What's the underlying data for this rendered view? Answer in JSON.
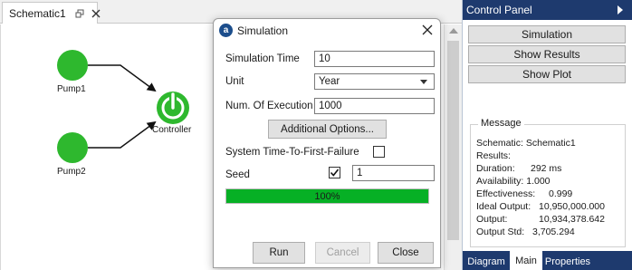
{
  "document": {
    "tab_label": "Schematic1"
  },
  "schematic": {
    "nodes": [
      {
        "label": "Pump1",
        "color": "#2eb82e",
        "shape": "circle"
      },
      {
        "label": "Pump2",
        "color": "#2eb82e",
        "shape": "circle"
      },
      {
        "label": "Controller",
        "color": "#2eb82e",
        "icon": "power-icon"
      }
    ],
    "connectors": [
      "Pump1 → Controller",
      "Pump2 → Controller"
    ]
  },
  "dialog": {
    "title": "Simulation",
    "app_icon_letter": "a",
    "fields": {
      "simulation_time_label": "Simulation Time",
      "simulation_time_value": "10",
      "unit_label": "Unit",
      "unit_value": "Year",
      "num_execution_label": "Num. Of Execution",
      "num_execution_value": "1000",
      "additional_options_label": "Additional Options...",
      "ttff_label": "System Time-To-First-Failure",
      "ttff_checked": false,
      "seed_label": "Seed",
      "seed_checked": true,
      "seed_value": "1"
    },
    "progress": {
      "fraction": 1.0,
      "text": "100%",
      "color": "#06b025"
    },
    "buttons": {
      "run": "Run",
      "cancel": "Cancel",
      "close": "Close"
    }
  },
  "control_panel": {
    "title": "Control Panel",
    "header_color": "#1e3a6e",
    "buttons": {
      "simulation": "Simulation",
      "show_results": "Show Results",
      "show_plot": "Show Plot"
    },
    "message": {
      "title": "Message",
      "lines": [
        {
          "label": "Schematic: Schematic1",
          "value": ""
        },
        {
          "label": "Results:",
          "value": ""
        },
        {
          "label": "Duration:",
          "value": "292 ms"
        },
        {
          "label": "Availability: 1.000",
          "value": ""
        },
        {
          "label": "Effectiveness:",
          "value": "0.999"
        },
        {
          "label": "Ideal Output:",
          "value": "10,950,000.000"
        },
        {
          "label": "Output:",
          "value": "10,934,378.642"
        },
        {
          "label": "Output Std:",
          "value": "3,705.294"
        }
      ]
    },
    "tabs": [
      "Diagram",
      "Main",
      "Properties"
    ],
    "active_tab": "Main"
  }
}
